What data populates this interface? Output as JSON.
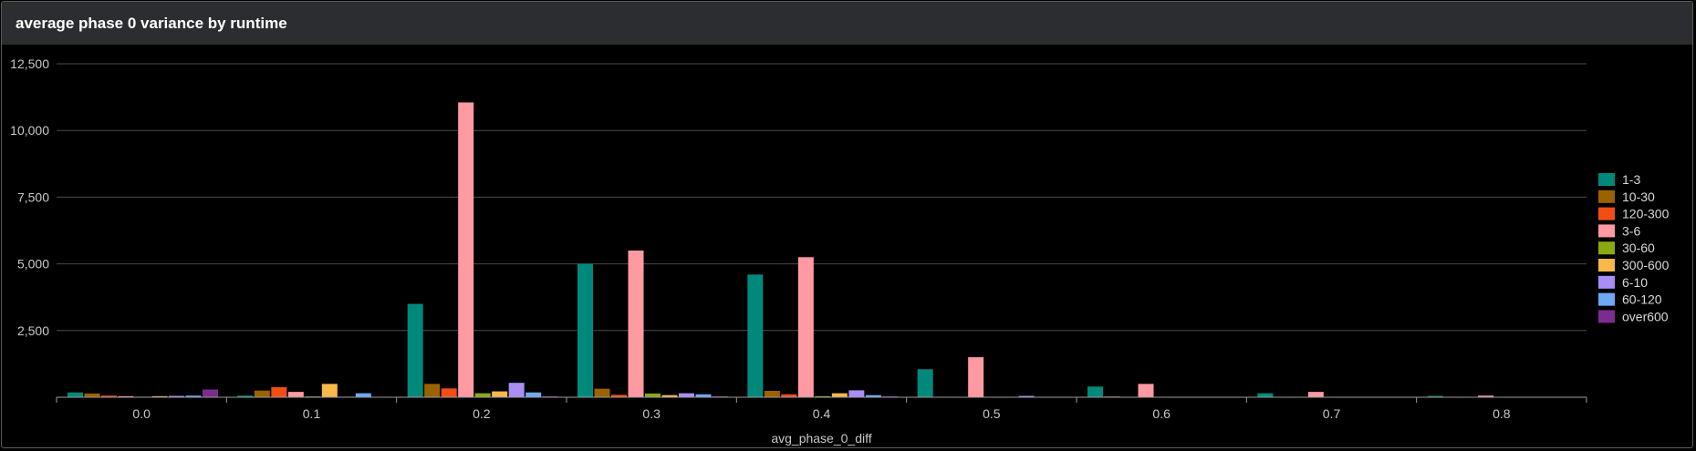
{
  "panel": {
    "title": "average phase 0 variance by runtime"
  },
  "chart_data": {
    "type": "bar",
    "title": "average phase 0 variance by runtime",
    "xlabel": "avg_phase_0_diff",
    "ylabel": "",
    "ylim": [
      0,
      12500
    ],
    "yticks": [
      "2,500",
      "5,000",
      "7,500",
      "10,000",
      "12,500"
    ],
    "ytick_values": [
      2500,
      5000,
      7500,
      10000,
      12500
    ],
    "grid": true,
    "legend_position": "right",
    "categories": [
      "0.0",
      "0.1",
      "0.2",
      "0.3",
      "0.4",
      "0.5",
      "0.6",
      "0.7",
      "0.8"
    ],
    "series": [
      {
        "name": "1-3",
        "color": "#00897b",
        "values": [
          180,
          60,
          3500,
          5000,
          4600,
          1050,
          400,
          150,
          50
        ]
      },
      {
        "name": "10-30",
        "color": "#9c6200",
        "values": [
          140,
          250,
          500,
          320,
          240,
          0,
          30,
          0,
          0
        ]
      },
      {
        "name": "120-300",
        "color": "#f24e13",
        "values": [
          60,
          380,
          330,
          90,
          110,
          0,
          0,
          0,
          0
        ]
      },
      {
        "name": "3-6",
        "color": "#ff9aa2",
        "values": [
          40,
          200,
          11050,
          5500,
          5250,
          1500,
          500,
          200,
          60
        ]
      },
      {
        "name": "30-60",
        "color": "#8aa812",
        "values": [
          20,
          30,
          150,
          140,
          40,
          0,
          0,
          0,
          0
        ]
      },
      {
        "name": "300-600",
        "color": "#f8b84a",
        "values": [
          40,
          500,
          220,
          80,
          150,
          0,
          0,
          0,
          0
        ]
      },
      {
        "name": "6-10",
        "color": "#a98ef5",
        "values": [
          50,
          20,
          540,
          150,
          260,
          50,
          0,
          0,
          0
        ]
      },
      {
        "name": "60-120",
        "color": "#6fa8f5",
        "values": [
          60,
          150,
          180,
          110,
          80,
          0,
          0,
          0,
          0
        ]
      },
      {
        "name": "over600",
        "color": "#7b2c8e",
        "values": [
          290,
          0,
          40,
          40,
          40,
          0,
          0,
          0,
          0
        ]
      }
    ]
  }
}
